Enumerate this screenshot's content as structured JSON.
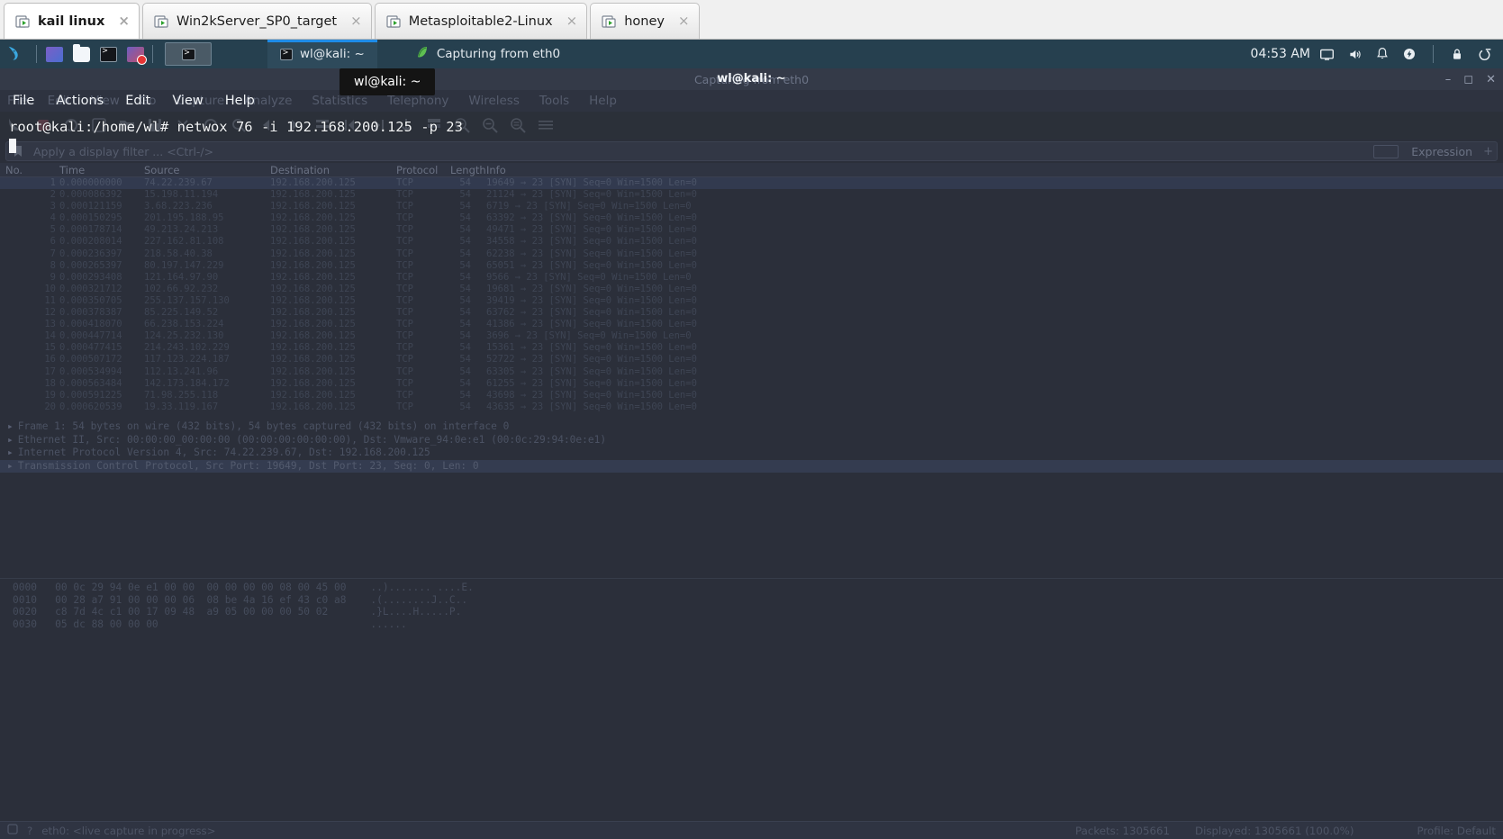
{
  "vm_tabs": [
    {
      "label": "kail linux",
      "active": true,
      "close": "×"
    },
    {
      "label": "Win2kServer_SP0_target",
      "active": false,
      "close": "×"
    },
    {
      "label": "Metasploitable2-Linux",
      "active": false,
      "close": "×"
    },
    {
      "label": "honey",
      "active": false,
      "close": "×"
    }
  ],
  "taskbar": {
    "launchers": [
      "files-icon",
      "folder-icon",
      "terminal-icon",
      "screen-recorder-icon"
    ],
    "windows": [
      {
        "label": "wl@kali: ~",
        "icon": "terminal-icon",
        "focused": true
      },
      {
        "label": "Capturing from eth0",
        "icon": "wireshark-icon",
        "focused": false
      }
    ],
    "clock": "04:53 AM",
    "tray_icons": [
      "display-icon",
      "volume-icon",
      "notification-bell-icon",
      "power-icon",
      "lock-icon",
      "logout-icon"
    ]
  },
  "wireshark": {
    "title": "Capturing from eth0",
    "window_controls": [
      "minimize",
      "maximize",
      "close"
    ],
    "menu": [
      "File",
      "Edit",
      "View",
      "Go",
      "Capture",
      "Analyze",
      "Statistics",
      "Telephony",
      "Wireless",
      "Tools",
      "Help"
    ],
    "toolbar_icons": [
      "start-capture-icon",
      "stop-capture-icon",
      "restart-capture-icon",
      "capture-options-icon",
      "open-file-icon",
      "save-file-icon",
      "close-file-icon",
      "reload-icon",
      "find-packet-icon",
      "go-back-icon",
      "go-forward-icon",
      "go-to-packet-icon",
      "go-first-icon",
      "go-last-icon",
      "autoscroll-icon",
      "colorize-icon",
      "zoom-in-icon",
      "zoom-out-icon",
      "zoom-reset-icon",
      "resize-columns-icon"
    ],
    "filter": {
      "placeholder": "Apply a display filter ... <Ctrl-/>",
      "value": "",
      "bookmark_icon": "bookmark-icon",
      "expression_label": "Expression"
    },
    "columns": [
      "No.",
      "Time",
      "Source",
      "Destination",
      "Protocol",
      "Length",
      "Info"
    ],
    "packets": [
      {
        "no": "1",
        "time": "0.000000000",
        "src": "74.22.239.67",
        "dst": "192.168.200.125",
        "proto": "TCP",
        "len": "54",
        "info": "19649 → 23 [SYN] Seq=0 Win=1500 Len=0",
        "selected": true
      },
      {
        "no": "2",
        "time": "0.000086392",
        "src": "15.198.11.194",
        "dst": "192.168.200.125",
        "proto": "TCP",
        "len": "54",
        "info": "21124 → 23 [SYN] Seq=0 Win=1500 Len=0",
        "selected": false
      },
      {
        "no": "3",
        "time": "0.000121159",
        "src": "3.68.223.236",
        "dst": "192.168.200.125",
        "proto": "TCP",
        "len": "54",
        "info": "6719 → 23 [SYN] Seq=0 Win=1500 Len=0",
        "selected": false
      },
      {
        "no": "4",
        "time": "0.000150295",
        "src": "201.195.188.95",
        "dst": "192.168.200.125",
        "proto": "TCP",
        "len": "54",
        "info": "63392 → 23 [SYN] Seq=0 Win=1500 Len=0",
        "selected": false
      },
      {
        "no": "5",
        "time": "0.000178714",
        "src": "49.213.24.213",
        "dst": "192.168.200.125",
        "proto": "TCP",
        "len": "54",
        "info": "49471 → 23 [SYN] Seq=0 Win=1500 Len=0",
        "selected": false
      },
      {
        "no": "6",
        "time": "0.000208014",
        "src": "227.162.81.108",
        "dst": "192.168.200.125",
        "proto": "TCP",
        "len": "54",
        "info": "34558 → 23 [SYN] Seq=0 Win=1500 Len=0",
        "selected": false
      },
      {
        "no": "7",
        "time": "0.000236397",
        "src": "218.58.40.38",
        "dst": "192.168.200.125",
        "proto": "TCP",
        "len": "54",
        "info": "62238 → 23 [SYN] Seq=0 Win=1500 Len=0",
        "selected": false
      },
      {
        "no": "8",
        "time": "0.000265397",
        "src": "80.197.147.229",
        "dst": "192.168.200.125",
        "proto": "TCP",
        "len": "54",
        "info": "65051 → 23 [SYN] Seq=0 Win=1500 Len=0",
        "selected": false
      },
      {
        "no": "9",
        "time": "0.000293408",
        "src": "121.164.97.90",
        "dst": "192.168.200.125",
        "proto": "TCP",
        "len": "54",
        "info": "9566 → 23 [SYN] Seq=0 Win=1500 Len=0",
        "selected": false
      },
      {
        "no": "10",
        "time": "0.000321712",
        "src": "102.66.92.232",
        "dst": "192.168.200.125",
        "proto": "TCP",
        "len": "54",
        "info": "19681 → 23 [SYN] Seq=0 Win=1500 Len=0",
        "selected": false
      },
      {
        "no": "11",
        "time": "0.000350705",
        "src": "255.137.157.130",
        "dst": "192.168.200.125",
        "proto": "TCP",
        "len": "54",
        "info": "39419 → 23 [SYN] Seq=0 Win=1500 Len=0",
        "selected": false
      },
      {
        "no": "12",
        "time": "0.000378387",
        "src": "85.225.149.52",
        "dst": "192.168.200.125",
        "proto": "TCP",
        "len": "54",
        "info": "63762 → 23 [SYN] Seq=0 Win=1500 Len=0",
        "selected": false
      },
      {
        "no": "13",
        "time": "0.000418070",
        "src": "66.238.153.224",
        "dst": "192.168.200.125",
        "proto": "TCP",
        "len": "54",
        "info": "41386 → 23 [SYN] Seq=0 Win=1500 Len=0",
        "selected": false
      },
      {
        "no": "14",
        "time": "0.000447714",
        "src": "124.25.232.130",
        "dst": "192.168.200.125",
        "proto": "TCP",
        "len": "54",
        "info": "3696 → 23 [SYN] Seq=0 Win=1500 Len=0",
        "selected": false
      },
      {
        "no": "15",
        "time": "0.000477415",
        "src": "214.243.102.229",
        "dst": "192.168.200.125",
        "proto": "TCP",
        "len": "54",
        "info": "15361 → 23 [SYN] Seq=0 Win=1500 Len=0",
        "selected": false
      },
      {
        "no": "16",
        "time": "0.000507172",
        "src": "117.123.224.187",
        "dst": "192.168.200.125",
        "proto": "TCP",
        "len": "54",
        "info": "52722 → 23 [SYN] Seq=0 Win=1500 Len=0",
        "selected": false
      },
      {
        "no": "17",
        "time": "0.000534994",
        "src": "112.13.241.96",
        "dst": "192.168.200.125",
        "proto": "TCP",
        "len": "54",
        "info": "63305 → 23 [SYN] Seq=0 Win=1500 Len=0",
        "selected": false
      },
      {
        "no": "18",
        "time": "0.000563484",
        "src": "142.173.184.172",
        "dst": "192.168.200.125",
        "proto": "TCP",
        "len": "54",
        "info": "61255 → 23 [SYN] Seq=0 Win=1500 Len=0",
        "selected": false
      },
      {
        "no": "19",
        "time": "0.000591225",
        "src": "71.98.255.118",
        "dst": "192.168.200.125",
        "proto": "TCP",
        "len": "54",
        "info": "43698 → 23 [SYN] Seq=0 Win=1500 Len=0",
        "selected": false
      },
      {
        "no": "20",
        "time": "0.000620539",
        "src": "19.33.119.167",
        "dst": "192.168.200.125",
        "proto": "TCP",
        "len": "54",
        "info": "43635 → 23 [SYN] Seq=0 Win=1500 Len=0",
        "selected": false
      }
    ],
    "details": [
      {
        "text": "Frame 1: 54 bytes on wire (432 bits), 54 bytes captured (432 bits) on interface 0",
        "selected": false
      },
      {
        "text": "Ethernet II, Src: 00:00:00_00:00:00 (00:00:00:00:00:00), Dst: Vmware_94:0e:e1 (00:0c:29:94:0e:e1)",
        "selected": false
      },
      {
        "text": "Internet Protocol Version 4, Src: 74.22.239.67, Dst: 192.168.200.125",
        "selected": false
      },
      {
        "text": "Transmission Control Protocol, Src Port: 19649, Dst Port: 23, Seq: 0, Len: 0",
        "selected": true
      }
    ],
    "hexdump": [
      {
        "offset": "0000",
        "bytes": "00 0c 29 94 0e e1 00 00  00 00 00 00 08 00 45 00",
        "ascii": "..)....... ....E."
      },
      {
        "offset": "0010",
        "bytes": "00 28 a7 91 00 00 00 06  08 be 4a 16 ef 43 c0 a8",
        "ascii": ".(........J..C.."
      },
      {
        "offset": "0020",
        "bytes": "c8 7d 4c c1 00 17 09 48  a9 05 00 00 00 50 02",
        "ascii": ".}L....H.....P."
      },
      {
        "offset": "0030",
        "bytes": "05 dc 88 00 00 00",
        "ascii": "......"
      }
    ],
    "statusbar": {
      "left": "eth0: <live capture in progress>",
      "packets": "Packets: 1305661",
      "displayed": "Displayed: 1305661 (100.0%)",
      "profile": "Profile: Default"
    }
  },
  "terminal": {
    "title": "wl@kali: ~",
    "menu": [
      "File",
      "Actions",
      "Edit",
      "View",
      "Help"
    ],
    "prompt": "root@kali:/home/wl#",
    "command": " netwox 76 -i 192.168.200.125 -p 23",
    "tooltip": "wl@kali: ~"
  }
}
